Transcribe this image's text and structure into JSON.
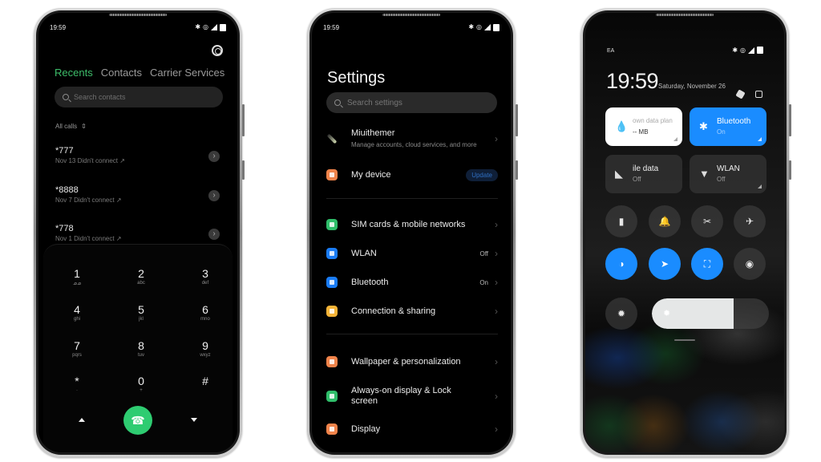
{
  "dialer": {
    "status_time": "19:59",
    "tabs": [
      {
        "label": "Recents",
        "active": true
      },
      {
        "label": "Contacts",
        "active": false
      },
      {
        "label": "Carrier Services",
        "active": false
      }
    ],
    "search_placeholder": "Search contacts",
    "filter_label": "All calls",
    "calls": [
      {
        "number": "*777",
        "detail": "Nov 13 Didn't connect"
      },
      {
        "number": "*8888",
        "detail": "Nov 7 Didn't connect"
      },
      {
        "number": "*778",
        "detail": "Nov 1 Didn't connect"
      }
    ],
    "keys": [
      {
        "digit": "1",
        "letters": "ᓄᓄ"
      },
      {
        "digit": "2",
        "letters": "abc"
      },
      {
        "digit": "3",
        "letters": "def"
      },
      {
        "digit": "4",
        "letters": "ghi"
      },
      {
        "digit": "5",
        "letters": "jkl"
      },
      {
        "digit": "6",
        "letters": "mno"
      },
      {
        "digit": "7",
        "letters": "pqrs"
      },
      {
        "digit": "8",
        "letters": "tuv"
      },
      {
        "digit": "9",
        "letters": "wxyz"
      },
      {
        "digit": "*",
        "letters": "·"
      },
      {
        "digit": "0",
        "letters": "+"
      },
      {
        "digit": "#",
        "letters": ""
      }
    ],
    "icons": {
      "call": "☎",
      "chevron": "›",
      "sort": "⇕",
      "outgoing": "↗"
    },
    "accent_color": "#2ecc71"
  },
  "settings": {
    "status_time": "19:59",
    "title": "Settings",
    "search_placeholder": "Search settings",
    "account": {
      "name": "Miuithemer",
      "subtitle": "Manage accounts, cloud services, and more"
    },
    "my_device": {
      "label": "My device",
      "badge": "Update"
    },
    "group1": [
      {
        "label": "SIM cards & mobile networks",
        "value": "",
        "color": "#2fbe6a"
      },
      {
        "label": "WLAN",
        "value": "Off",
        "color": "#1a7cf5"
      },
      {
        "label": "Bluetooth",
        "value": "On",
        "color": "#1a7cf5"
      },
      {
        "label": "Connection & sharing",
        "value": "",
        "color": "#f5b437"
      }
    ],
    "group2": [
      {
        "label": "Wallpaper & personalization",
        "color": "#f0834a"
      },
      {
        "label": "Always-on display & Lock screen",
        "color": "#2fbe6a"
      },
      {
        "label": "Display",
        "color": "#f0834a"
      }
    ],
    "chevron": "›"
  },
  "control_center": {
    "carrier": "EA",
    "time": "19:59",
    "date": "Saturday, November 26",
    "tiles": [
      {
        "name": "own data plan",
        "sub": "-- MB",
        "style": "light",
        "icon": "💧"
      },
      {
        "name": "Bluetooth",
        "sub": "On",
        "style": "blue",
        "icon": "✱"
      },
      {
        "name": "ile data",
        "sub": "Off",
        "style": "dark",
        "icon": "◣"
      },
      {
        "name": "WLAN",
        "sub": "Off",
        "style": "dark",
        "icon": "▼"
      }
    ],
    "toggles_row1": [
      {
        "name": "flashlight",
        "glyph": "▮",
        "on": false
      },
      {
        "name": "silent-bell",
        "glyph": "🔔",
        "on": false
      },
      {
        "name": "screenshot-scissors",
        "glyph": "✂",
        "on": false
      },
      {
        "name": "airplane",
        "glyph": "✈",
        "on": false
      }
    ],
    "toggles_row2": [
      {
        "name": "dark-mode",
        "glyph": "◑",
        "on": true
      },
      {
        "name": "location",
        "glyph": "➤",
        "on": true
      },
      {
        "name": "auto-rotate",
        "glyph": "⛶",
        "on": true
      },
      {
        "name": "screen-record",
        "glyph": "◉",
        "on": false
      }
    ],
    "brightness_level": 0.7,
    "sun_glyph": "✹",
    "accent_color": "#1a8cff"
  }
}
